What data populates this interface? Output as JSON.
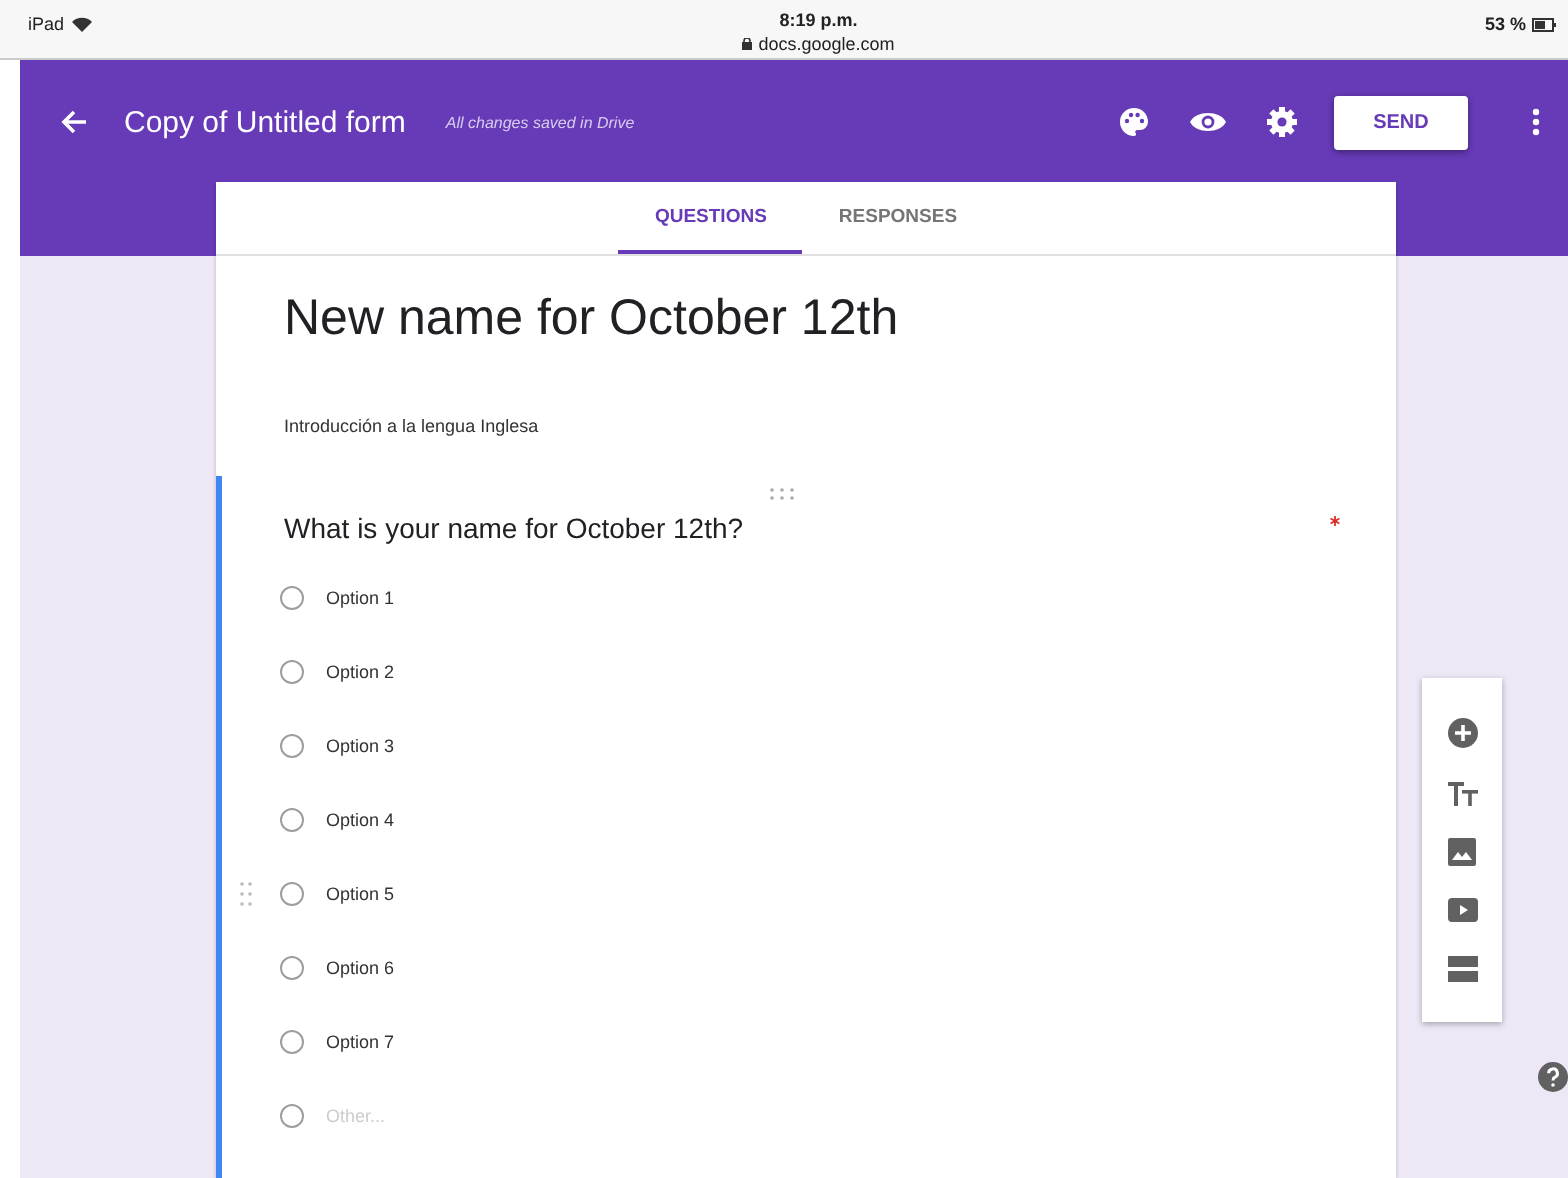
{
  "status_bar": {
    "device": "iPad",
    "time": "8:19 p.m.",
    "url": "docs.google.com",
    "battery": "53 %"
  },
  "header": {
    "title": "Copy of Untitled form",
    "save_status": "All changes saved in Drive",
    "send_button": "SEND"
  },
  "tabs": [
    {
      "label": "QUESTIONS",
      "selected": true
    },
    {
      "label": "RESPONSES",
      "selected": false
    }
  ],
  "form": {
    "title": "New name for October 12th",
    "description": "Introducción a la lengua Inglesa"
  },
  "question": {
    "title": "What is your name for October 12th?",
    "required": true,
    "options": [
      {
        "label": "Option 1",
        "kind": "option",
        "selected": false
      },
      {
        "label": "Option 2",
        "kind": "option",
        "selected": false
      },
      {
        "label": "Option 3",
        "kind": "option",
        "selected": false
      },
      {
        "label": "Option 4",
        "kind": "option",
        "selected": false
      },
      {
        "label": "Option 5",
        "kind": "option",
        "selected": false
      },
      {
        "label": "Option 6",
        "kind": "option",
        "selected": false
      },
      {
        "label": "Option 7",
        "kind": "option",
        "selected": false
      },
      {
        "label": "Other...",
        "kind": "other",
        "selected": false
      }
    ]
  }
}
